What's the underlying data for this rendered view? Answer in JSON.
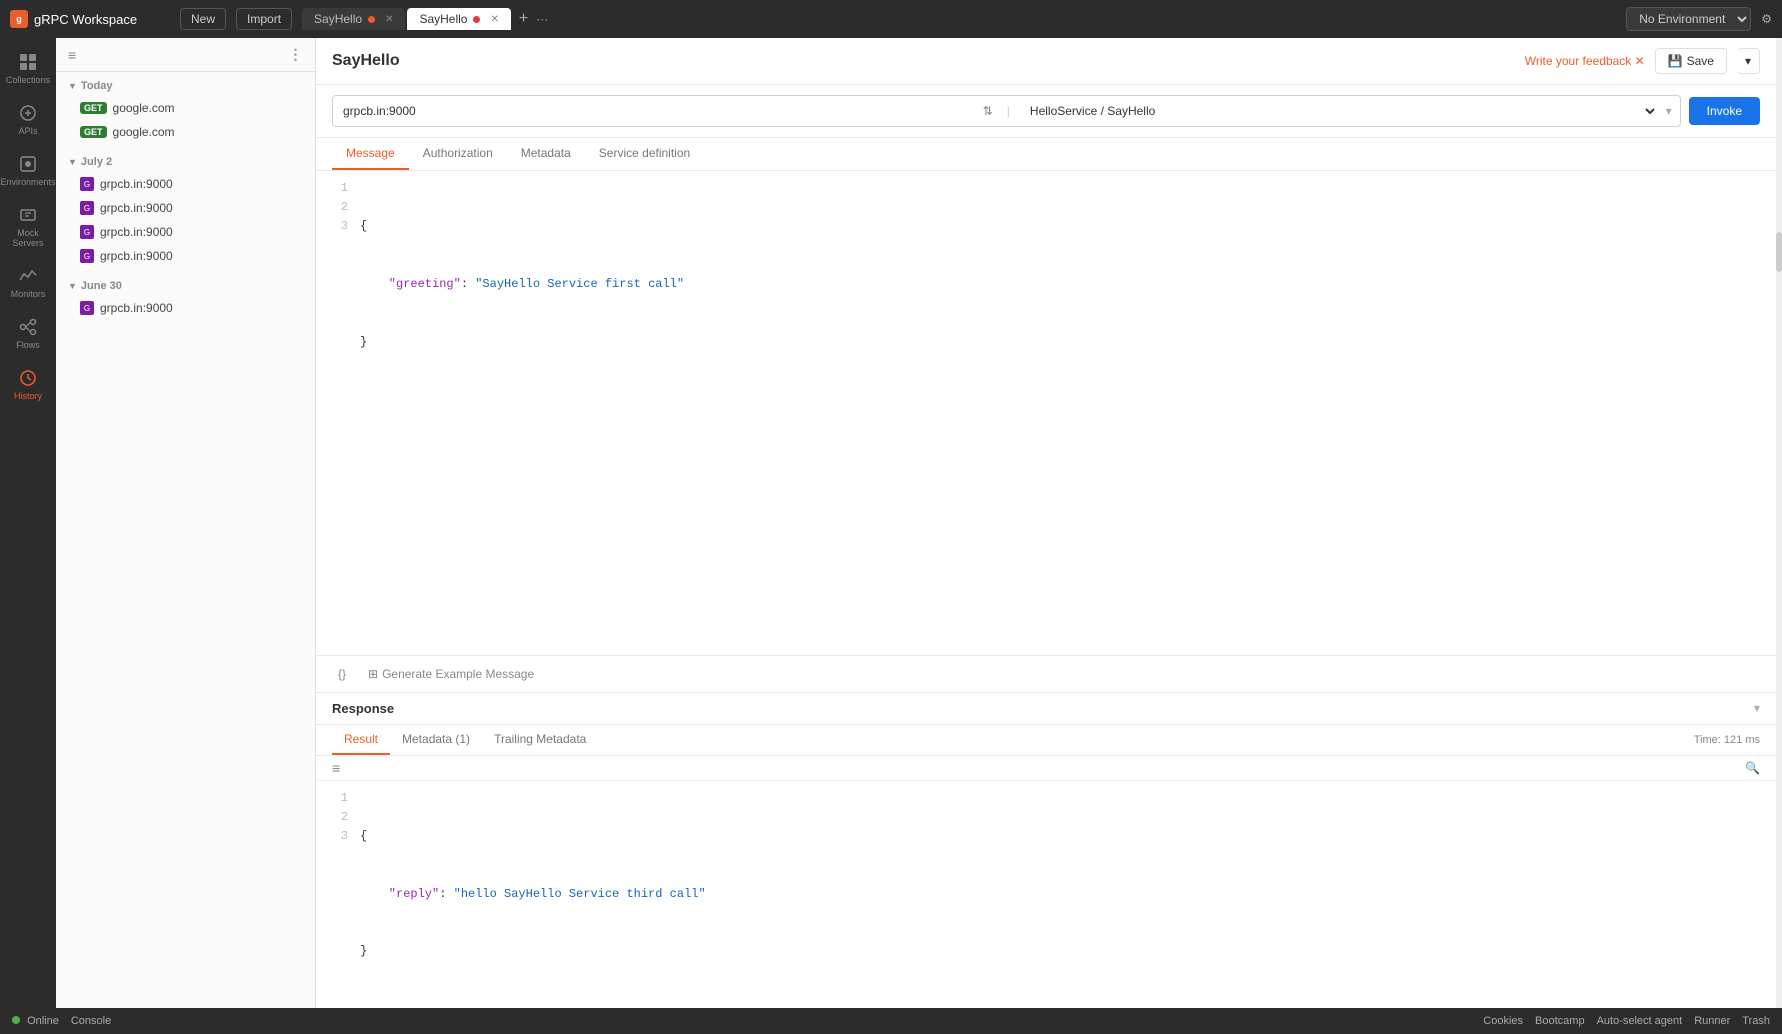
{
  "app": {
    "name": "gRPC Workspace",
    "logo_text": "g"
  },
  "top_bar": {
    "new_btn": "New",
    "import_btn": "Import",
    "tabs": [
      {
        "label": "SayHello",
        "dot_color": "orange",
        "active": false
      },
      {
        "label": "SayHello",
        "dot_color": "red",
        "active": true
      }
    ],
    "add_tab": "+",
    "more_btn": "···",
    "env_label": "No Environment"
  },
  "sidebar_icons": [
    {
      "id": "collections",
      "label": "Collections",
      "icon": "grid"
    },
    {
      "id": "apis",
      "label": "APIs",
      "icon": "api"
    },
    {
      "id": "environments",
      "label": "Environments",
      "icon": "env"
    },
    {
      "id": "mock-servers",
      "label": "Mock Servers",
      "icon": "mock"
    },
    {
      "id": "monitors",
      "label": "Monitors",
      "icon": "monitor"
    },
    {
      "id": "flows",
      "label": "Flows",
      "icon": "flows"
    },
    {
      "id": "history",
      "label": "History",
      "icon": "history",
      "active": true
    }
  ],
  "sidebar": {
    "header_icons": [
      "≡",
      "⋮"
    ],
    "groups": [
      {
        "label": "Today",
        "expanded": true,
        "items": [
          {
            "badge": "GET",
            "badge_type": "get",
            "text": "google.com"
          },
          {
            "badge": "GET",
            "badge_type": "get",
            "text": "google.com"
          }
        ]
      },
      {
        "label": "July 2",
        "expanded": true,
        "items": [
          {
            "badge": "G",
            "badge_type": "grpc",
            "text": "grpcb.in:9000"
          },
          {
            "badge": "G",
            "badge_type": "grpc",
            "text": "grpcb.in:9000"
          },
          {
            "badge": "G",
            "badge_type": "grpc",
            "text": "grpcb.in:9000"
          },
          {
            "badge": "G",
            "badge_type": "grpc",
            "text": "grpcb.in:9000"
          }
        ]
      },
      {
        "label": "June 30",
        "expanded": true,
        "items": [
          {
            "badge": "G",
            "badge_type": "grpc",
            "text": "grpcb.in:9000"
          }
        ]
      }
    ]
  },
  "content": {
    "title": "SayHello",
    "feedback_label": "Write your feedback ✕",
    "save_label": "Save",
    "url": "grpcb.in:9000",
    "service_path": "HelloService / SayHello",
    "invoke_label": "Invoke",
    "tabs": [
      {
        "label": "Message",
        "active": true
      },
      {
        "label": "Authorization",
        "active": false
      },
      {
        "label": "Metadata",
        "active": false
      },
      {
        "label": "Service definition",
        "active": false
      }
    ],
    "editor": {
      "lines": [
        {
          "num": "1",
          "content": "{"
        },
        {
          "num": "2",
          "content": "    \"greeting\": \"SayHello Service first call\""
        },
        {
          "num": "3",
          "content": "}"
        }
      ]
    },
    "bottom_actions": [
      {
        "label": "{}",
        "id": "braces-btn"
      },
      {
        "label": "⊞ Generate Example Message",
        "id": "generate-btn"
      }
    ],
    "response": {
      "title": "Response",
      "tabs": [
        {
          "label": "Result",
          "active": true
        },
        {
          "label": "Metadata (1)",
          "active": false
        },
        {
          "label": "Trailing Metadata",
          "active": false
        }
      ],
      "time_label": "Time:",
      "time_value": "121 ms",
      "lines": [
        {
          "num": "1",
          "content": "{"
        },
        {
          "num": "2",
          "content": "    \"reply\": \"hello SayHello Service third call\""
        },
        {
          "num": "3",
          "content": "}"
        }
      ]
    }
  },
  "status_bar": {
    "online_label": "Online",
    "console_label": "Console",
    "cookies_label": "Cookies",
    "bootcamp_label": "Bootcamp",
    "auto_agent_label": "Auto-select agent",
    "runner_label": "Runner",
    "trash_label": "Trash"
  }
}
